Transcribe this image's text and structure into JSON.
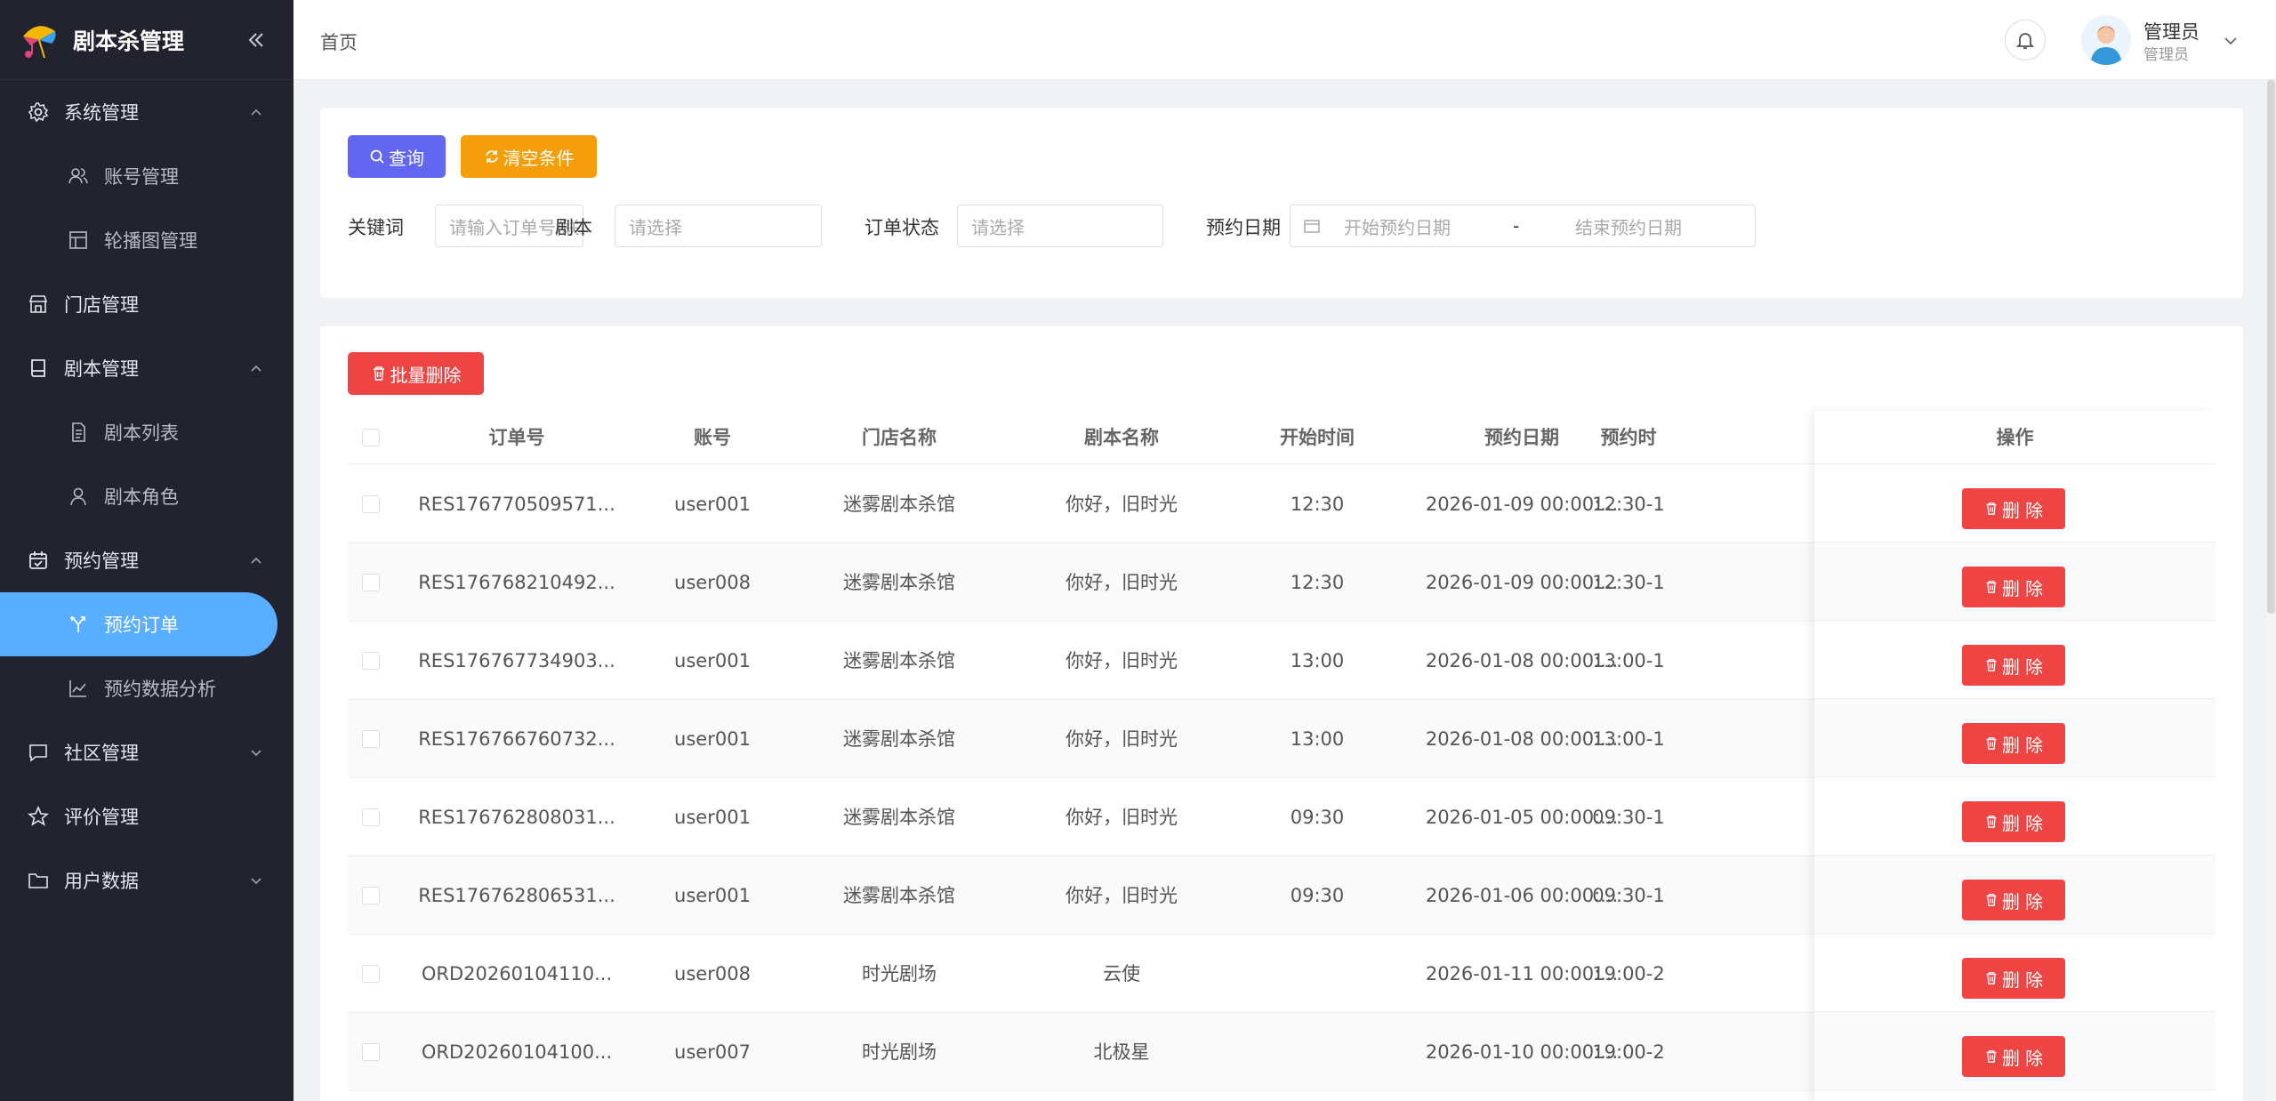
{
  "brand": {
    "title": "剧本杀管理"
  },
  "sidebar": {
    "items": [
      {
        "label": "系统管理",
        "level": "top",
        "icon": "gear-icon",
        "arrow": "up"
      },
      {
        "label": "账号管理",
        "level": "sub",
        "icon": "users-icon"
      },
      {
        "label": "轮播图管理",
        "level": "sub",
        "icon": "layout-icon"
      },
      {
        "label": "门店管理",
        "level": "top",
        "icon": "store-icon"
      },
      {
        "label": "剧本管理",
        "level": "top",
        "icon": "book-icon",
        "arrow": "up"
      },
      {
        "label": "剧本列表",
        "level": "sub",
        "icon": "document-icon"
      },
      {
        "label": "剧本角色",
        "level": "sub",
        "icon": "user-icon"
      },
      {
        "label": "预约管理",
        "level": "top",
        "icon": "calendar-icon",
        "arrow": "up"
      },
      {
        "label": "预约订单",
        "level": "sub",
        "icon": "branch-icon",
        "active": true
      },
      {
        "label": "预约数据分析",
        "level": "sub",
        "icon": "line-chart-icon"
      },
      {
        "label": "社区管理",
        "level": "top",
        "icon": "chat-icon",
        "arrow": "down"
      },
      {
        "label": "评价管理",
        "level": "top",
        "icon": "star-icon"
      },
      {
        "label": "用户数据",
        "level": "top",
        "icon": "folder-icon",
        "arrow": "down"
      }
    ]
  },
  "header": {
    "breadcrumb": "首页",
    "user_name": "管理员",
    "user_role": "管理员"
  },
  "search": {
    "query_label": "查询",
    "clear_label": "清空条件",
    "keyword_label": "关键词",
    "keyword_placeholder": "请输入订单号/联系人/联系",
    "script_label": "剧本",
    "script_placeholder": "请选择",
    "status_label": "订单状态",
    "status_placeholder": "请选择",
    "date_label": "预约日期",
    "start_placeholder": "开始预约日期",
    "range_sep": "-",
    "end_placeholder": "结束预约日期"
  },
  "table": {
    "batch_delete_label": "批量删除",
    "columns": [
      "订单号",
      "账号",
      "门店名称",
      "剧本名称",
      "开始时间",
      "预约日期",
      "预约时"
    ],
    "action_column": "操作",
    "delete_label": "删 除",
    "rows": [
      {
        "order_no": "RES176770509571...",
        "account": "user001",
        "store": "迷雾剧本杀馆",
        "script": "你好，旧时光",
        "start": "12:30",
        "date": "2026-01-09 00:00:...",
        "time": "12:30-1"
      },
      {
        "order_no": "RES176768210492...",
        "account": "user008",
        "store": "迷雾剧本杀馆",
        "script": "你好，旧时光",
        "start": "12:30",
        "date": "2026-01-09 00:00:...",
        "time": "12:30-1"
      },
      {
        "order_no": "RES176767734903...",
        "account": "user001",
        "store": "迷雾剧本杀馆",
        "script": "你好，旧时光",
        "start": "13:00",
        "date": "2026-01-08 00:00:...",
        "time": "13:00-1"
      },
      {
        "order_no": "RES176766760732...",
        "account": "user001",
        "store": "迷雾剧本杀馆",
        "script": "你好，旧时光",
        "start": "13:00",
        "date": "2026-01-08 00:00:...",
        "time": "13:00-1"
      },
      {
        "order_no": "RES176762808031...",
        "account": "user001",
        "store": "迷雾剧本杀馆",
        "script": "你好，旧时光",
        "start": "09:30",
        "date": "2026-01-05 00:00:...",
        "time": "09:30-1"
      },
      {
        "order_no": "RES176762806531...",
        "account": "user001",
        "store": "迷雾剧本杀馆",
        "script": "你好，旧时光",
        "start": "09:30",
        "date": "2026-01-06 00:00:...",
        "time": "09:30-1"
      },
      {
        "order_no": "ORD20260104110...",
        "account": "user008",
        "store": "时光剧场",
        "script": "云使",
        "start": "",
        "date": "2026-01-11 00:00:...",
        "time": "19:00-2"
      },
      {
        "order_no": "ORD20260104100...",
        "account": "user007",
        "store": "时光剧场",
        "script": "北极星",
        "start": "",
        "date": "2026-01-10 00:00:...",
        "time": "19:00-2"
      }
    ]
  },
  "colors": {
    "sidebar_bg": "#22232e",
    "active_item": "#5aaeff",
    "query_button": "#6366f1",
    "clear_button": "#f59e0b",
    "danger": "#ef4444"
  }
}
